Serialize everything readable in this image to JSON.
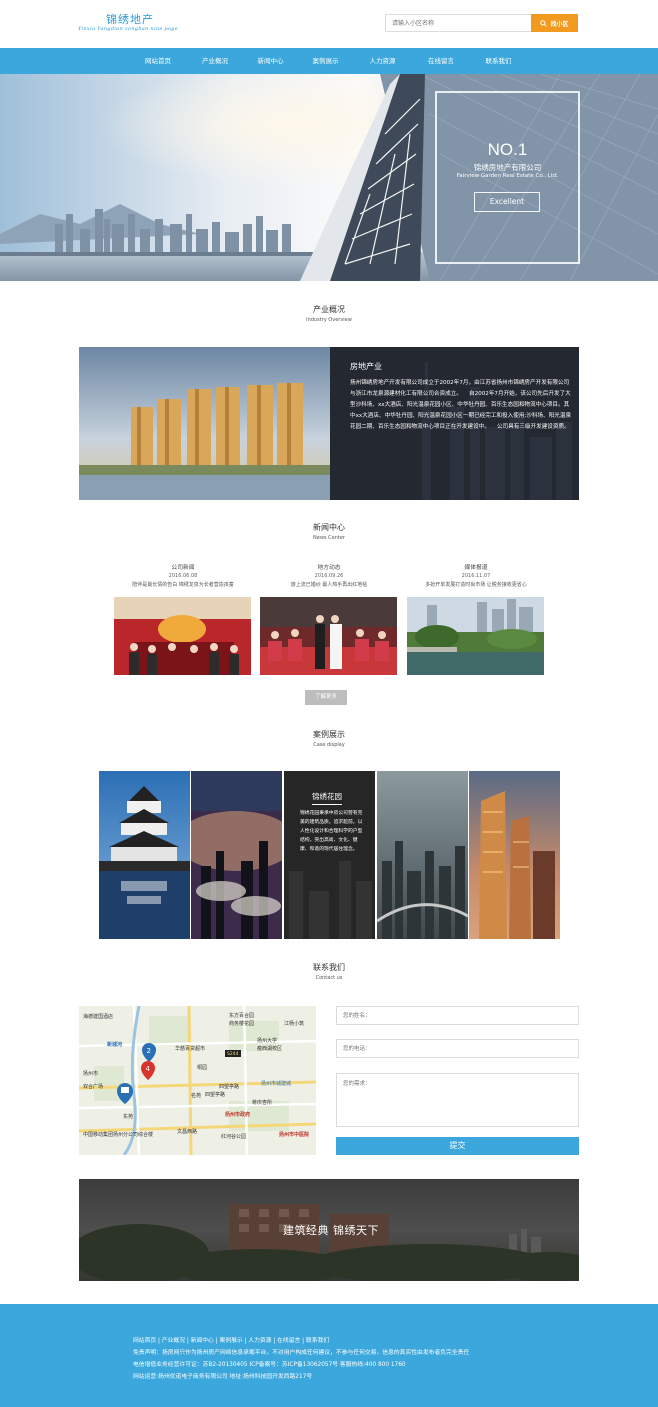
{
  "header": {
    "logo_cn": "锦绣地产",
    "logo_en": "Yinxiu Yangdian zongban nine page",
    "search_placeholder": "请输入小区名称",
    "search_button": "找小区"
  },
  "nav": [
    "网站首页",
    "产业概况",
    "新闻中心",
    "案例展示",
    "人力资源",
    "在线留言",
    "联系我们"
  ],
  "hero": {
    "title": "NO.1",
    "company": "锦绣房地产有限公司",
    "company_en": "Fairview Garden Real Estate Co., Ltd.",
    "button": "Excellent"
  },
  "overview": {
    "title": "产业概况",
    "subtitle": "Industry Overview",
    "heading": "房地产业",
    "paragraph": "扬州锦绣房地产开发有限公司成立于2002年7月，由江苏省扬州市锦绣房产开发有限公司与浙江市龙泉源建材化工有限公司合资成立。    自2002年7月开始，该公司先后开发了大型沙科场、xx大酒店、阳光温泉花园小区、中华牡丹园、百乐生态园和物流中心项目。其中xx大酒店、中华牡丹园、阳光温泉花园小区一期已经完工和投入使用;沙科场、阳光温泉花园二期、百乐生态园和物流中心项目正在开发建设中。    公司具有三级开发建设资质。"
  },
  "news": {
    "title": "新闻中心",
    "subtitle": "News Center",
    "items": [
      {
        "category": "公司新闻",
        "date": "2016.06.08",
        "summary": "陪伴是最长情的告白 锦绣龙泉为长者营造孩童"
      },
      {
        "category": "地方动态",
        "date": "2016.09.26",
        "summary": "旅上流已婚纱 最人热手再出红地毯"
      },
      {
        "category": "媒体报道",
        "date": "2016.11.07",
        "summary": "多抢开单发展打造时尚市场 让税务接收更省心"
      }
    ],
    "more_button": "了解更多"
  },
  "cases": {
    "title": "案例展示",
    "subtitle": "Case display",
    "featured_title": "锦绣花园",
    "featured_desc": "锦绣花园秉承中房公司营有完美的建筑品质，追求超前，以人性化设计和合理科学的户型结构，突出高尚、文化、健康、和谐的现代居住理念。"
  },
  "contact": {
    "title": "联系我们",
    "subtitle": "Contact us",
    "name_placeholder": "您的姓名：",
    "phone_placeholder": "您的电话：",
    "needs_placeholder": "您的需求：",
    "submit": "提交",
    "map_labels": [
      "海德建国酒店",
      "东方百合园",
      "商务楼花园",
      "江杨小筑",
      "新城河",
      "华慈百货超市",
      "扬州大学",
      "瘦西湖校区",
      "S244",
      "桐园",
      "扬州市",
      "双合广场",
      "四望亭路",
      "扬州市城建城",
      "名苑",
      "四望亭路",
      "蒋庆杏所",
      "广场",
      "东苑",
      "扬州市政府",
      "中国移动集团扬州分公司综合楼",
      "文昌西路",
      "红河谷公园",
      "扬州市中医院"
    ]
  },
  "banner": {
    "slogan": "建筑经典 锦绣天下"
  },
  "footer": {
    "links": "网站首页 | 产业概况 | 新闻中心 | 案例展示 | 人力资源 | 在线留言 | 联系我们",
    "disclaimer": "免责声明：扬房网只作为扬州房产网络信息承载平台，不对用户构成任何建议，不参与任何交易，信息的真实性由发布者负完全责任",
    "license": "电信增值业务经营许可证：苏B2-20130405 ICP备案号：苏ICP备13062057号 客服热线:400 800 1760",
    "operator": "网站运营:扬州优诺电子商务有限公司 地址:扬州科技园开发西路217号"
  },
  "colors": {
    "accent_blue": "#3ba7dc",
    "search_orange": "#f29a1f",
    "more_gray": "#bdbdbd"
  }
}
